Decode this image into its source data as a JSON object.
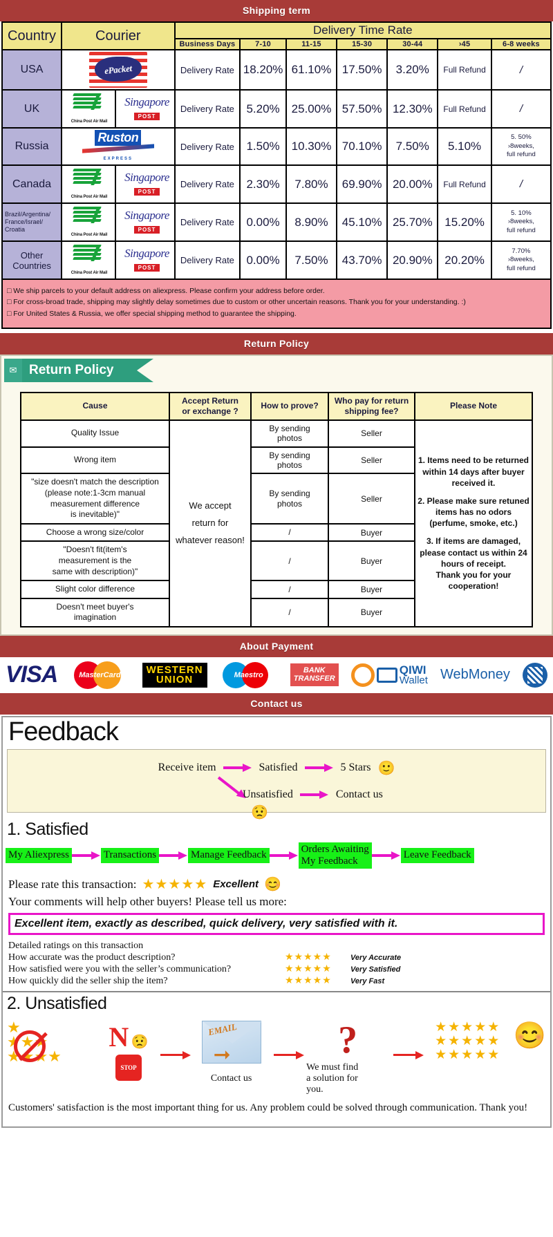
{
  "banners": {
    "shipping": "Shipping term",
    "return": "Return Policy",
    "payment": "About Payment",
    "contact": "Contact us"
  },
  "shipping_table": {
    "headers": {
      "country": "Country",
      "courier": "Courier",
      "delivery_time_rate": "Delivery Time Rate",
      "business_days": "Business Days",
      "ranges": [
        "7-10",
        "11-15",
        "15-30",
        "30-44",
        "›45",
        "6-8 weeks"
      ]
    },
    "rows": [
      {
        "country": "USA",
        "couriers": [
          "epacket"
        ],
        "label": "Delivery Rate",
        "values": [
          "18.20%",
          "61.10%",
          "17.50%",
          "3.20%",
          "Full Refund",
          "/"
        ]
      },
      {
        "country": "UK",
        "couriers": [
          "china-post",
          "singapore-post"
        ],
        "label": "Delivery Rate",
        "values": [
          "5.20%",
          "25.00%",
          "57.50%",
          "12.30%",
          "Full Refund",
          "/"
        ]
      },
      {
        "country": "Russia",
        "couriers": [
          "ruston"
        ],
        "label": "Delivery Rate",
        "values": [
          "1.50%",
          "10.30%",
          "70.10%",
          "7.50%",
          "5.10%",
          "5. 50%\n›8weeks,\nfull refund"
        ]
      },
      {
        "country": "Canada",
        "couriers": [
          "china-post",
          "singapore-post"
        ],
        "label": "Delivery Rate",
        "values": [
          "2.30%",
          "7.80%",
          "69.90%",
          "20.00%",
          "Full Refund",
          "/"
        ]
      },
      {
        "country": "Brazil/Argentina/\nFrance/Israel/\nCroatia",
        "couriers": [
          "china-post",
          "singapore-post"
        ],
        "label": "Delivery Rate",
        "values": [
          "0.00%",
          "8.90%",
          "45.10%",
          "25.70%",
          "15.20%",
          "5. 10%\n›8weeks,\nfull refund"
        ]
      },
      {
        "country": "Other Countries",
        "couriers": [
          "china-post",
          "singapore-post"
        ],
        "label": "Delivery Rate",
        "values": [
          "0.00%",
          "7.50%",
          "43.70%",
          "20.90%",
          "20.20%",
          "7.70%\n›8weeks,\nfull refund"
        ]
      }
    ],
    "notes": [
      "We ship parcels to your default address on aliexpress. Please confirm your address before order.",
      "For cross-broad trade, shipping may slightly delay sometimes due to custom or other uncertain reasons. Thank you for your understanding. :)",
      "For United States & Russia, we offer special shipping method to guarantee the shipping."
    ]
  },
  "return_policy": {
    "tab_label": "Return Policy",
    "tab_icon": "mail-icon",
    "headers": [
      "Cause",
      "Accept Return\nor exchange ?",
      "How to prove?",
      "Who pay for return\nshipping fee?",
      "Please Note"
    ],
    "accept_text": "We accept\nreturn for\nwhatever reason!",
    "rows": [
      {
        "cause": "Quality Issue",
        "prove": "By sending\nphotos",
        "who": "Seller"
      },
      {
        "cause": "Wrong item",
        "prove": "By sending\nphotos",
        "who": "Seller"
      },
      {
        "cause": "\"size doesn't match the description\n(please note:1-3cm manual\nmeasurement difference\nis inevitable)\"",
        "prove": "By sending\nphotos",
        "who": "Seller"
      },
      {
        "cause": "Choose a wrong size/color",
        "prove": "/",
        "who": "Buyer"
      },
      {
        "cause": "\"Doesn't fit(item's\nmeasurement is the\nsame with description)\"",
        "prove": "/",
        "who": "Buyer"
      },
      {
        "cause": "Slight color difference",
        "prove": "/",
        "who": "Buyer"
      },
      {
        "cause": "Doesn't meet buyer's\nimagination",
        "prove": "/",
        "who": "Buyer"
      }
    ],
    "notes": [
      "1. Items need to be returned within 14 days after buyer received it.",
      "2. Please make sure retuned items has no odors (perfume, smoke, etc.)",
      "3. If items are damaged, please contact us within 24 hours of receipt.\nThank you for your cooperation!"
    ]
  },
  "payment_methods": [
    {
      "name": "visa",
      "label": "VISA"
    },
    {
      "name": "mastercard",
      "label": "MasterCard"
    },
    {
      "name": "western-union",
      "line1": "WESTERN",
      "line2": "UNION"
    },
    {
      "name": "maestro",
      "label": "Maestro"
    },
    {
      "name": "bank-transfer",
      "line1": "BANK",
      "line2": "TRANSFER"
    },
    {
      "name": "qiwi-wallet",
      "line1": "QIWI",
      "line2": "Wallet"
    },
    {
      "name": "webmoney",
      "label": "WebMoney"
    }
  ],
  "feedback": {
    "title": "Feedback",
    "flow": {
      "receive_item": "Receive item",
      "satisfied": "Satisfied",
      "five_stars": "5 Stars",
      "happy_emoji": "🙂",
      "unsatisfied": "Unsatisfied",
      "contact_us": "Contact us",
      "sad_emoji": "😟"
    },
    "satisfied": {
      "heading": "1. Satisfied",
      "steps": [
        "My Aliexpress",
        "Transactions",
        "Manage Feedback",
        "Orders Awaiting\nMy Feedback",
        "Leave Feedback"
      ],
      "rate_label": "Please rate this transaction:",
      "stars": "★★★★★",
      "rate_word": "Excellent",
      "rate_emoji": "😊",
      "tell_more": "Your comments will help other buyers! Please tell us more:",
      "comment": "Excellent item, exactly as described, quick delivery, very satisfied with it.",
      "detail_heading": "Detailed ratings on this transaction",
      "details": [
        {
          "question": "How accurate was the product description?",
          "stars": "★★★★★",
          "label": "Very Accurate"
        },
        {
          "question": "How satisfied were you with the seller’s communication?",
          "stars": "★★★★★",
          "label": "Very Satisfied"
        },
        {
          "question": "How quickly did the seller ship the item?",
          "stars": "★★★★★",
          "label": "Very Fast"
        }
      ]
    },
    "unsatisfied": {
      "heading": "2. Unsatisfied",
      "no_label": "N",
      "stop_label": "STOP",
      "sad_emoji": "😟",
      "email_label": "EMAIL",
      "contact_caption": "Contact us",
      "question_caption": "We must find\na solution for\nyou.",
      "happy_emoji": "😊",
      "closing": "Customers' satisfaction is the most important thing for us. Any problem could be solved through communication. Thank you!"
    }
  },
  "colors": {
    "banner_red": "#a83b38",
    "header_yellow": "#f0e68c",
    "country_purple": "#b6b2d8",
    "note_pink": "#f49ba5",
    "tab_green": "#2e9e7e",
    "step_green": "#17f017",
    "magenta": "#e915c8",
    "star_gold": "#f5b301"
  }
}
